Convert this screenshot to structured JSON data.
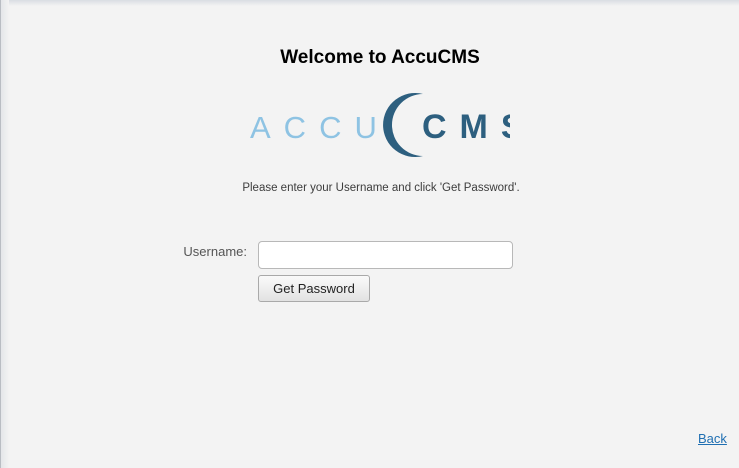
{
  "page": {
    "title": "Welcome to AccuCMS",
    "logo": {
      "text_left": "ACCU",
      "text_right": "CMS",
      "light_color": "#8ec3e3",
      "dark_color": "#2d5f7f"
    },
    "instructions": "Please enter your Username and click 'Get Password'."
  },
  "form": {
    "username_label": "Username:",
    "username_value": "",
    "get_password_label": "Get Password"
  },
  "footer": {
    "back_label": "Back"
  }
}
